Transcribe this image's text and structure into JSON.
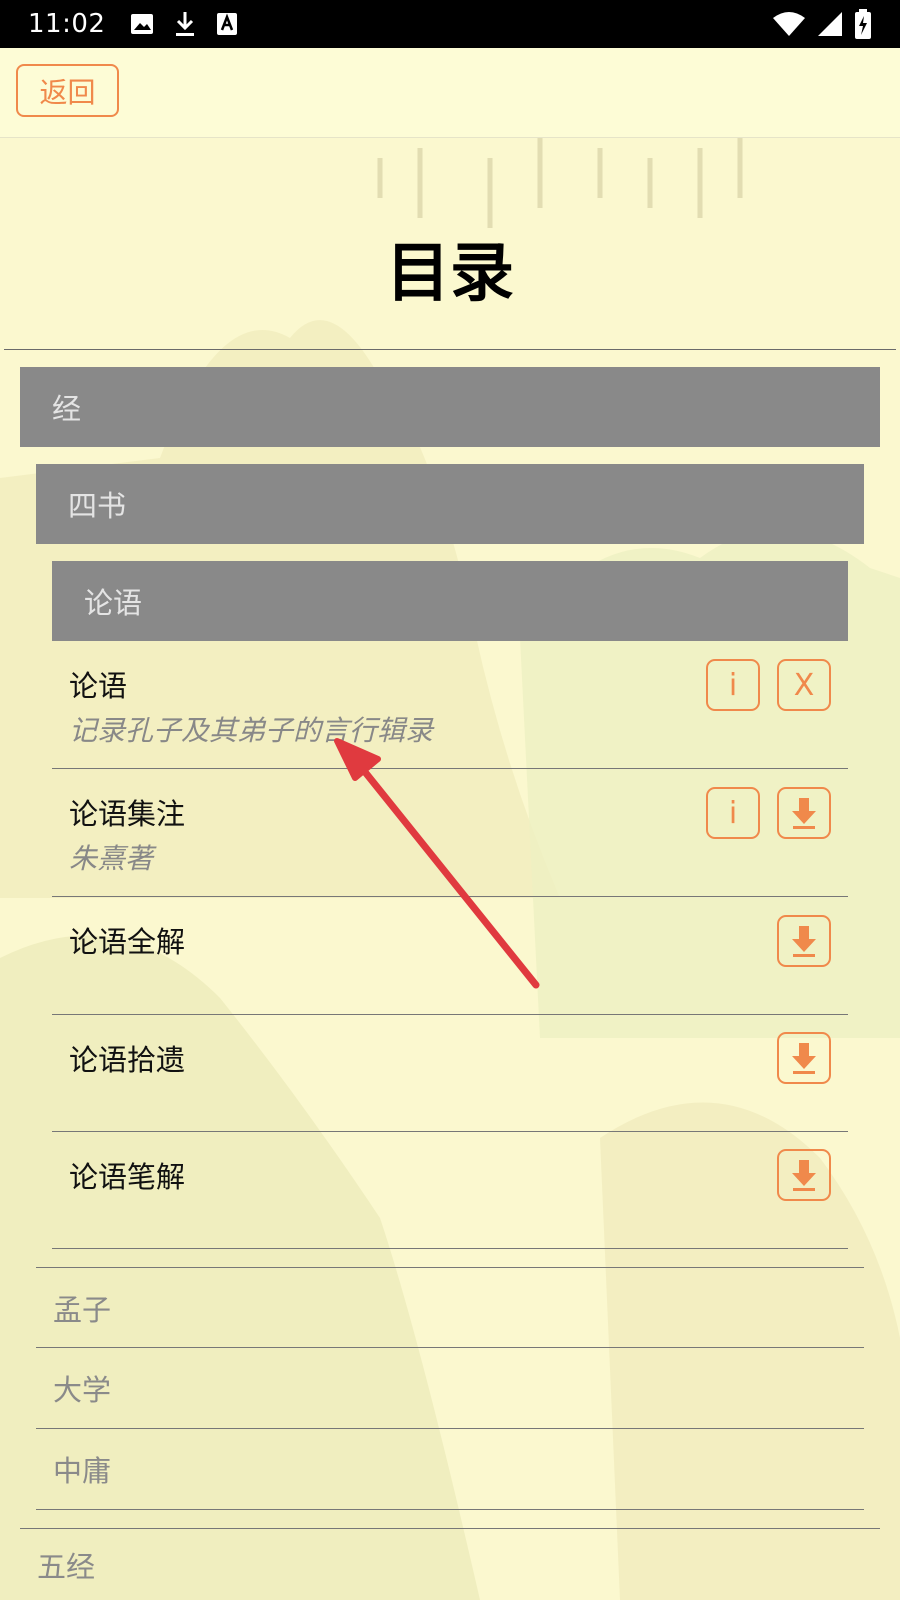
{
  "status_bar": {
    "time": "11:02",
    "left_icons": [
      "image-icon",
      "download-icon",
      "a-font-icon"
    ],
    "right_icons": [
      "wifi-icon",
      "signal-icon",
      "battery-charging-icon"
    ]
  },
  "topbar": {
    "back_label": "返回"
  },
  "page_title": "目录",
  "sections": {
    "level1": "经",
    "level2": "四书",
    "level3": "论语"
  },
  "books": [
    {
      "title": "论语",
      "subtitle": "记录孔子及其弟子的言行辑录",
      "info_label": "i",
      "action_label": "X"
    },
    {
      "title": "论语集注",
      "subtitle": "朱熹著",
      "info_label": "i"
    },
    {
      "title": "论语全解"
    },
    {
      "title": "论语拾遗"
    },
    {
      "title": "论语笔解"
    }
  ],
  "sibling_items": [
    "孟子",
    "大学",
    "中庸"
  ],
  "next_section": "五经",
  "colors": {
    "accent": "#f0894b",
    "section_bar": "#898989",
    "background": "#fdfbd8"
  }
}
